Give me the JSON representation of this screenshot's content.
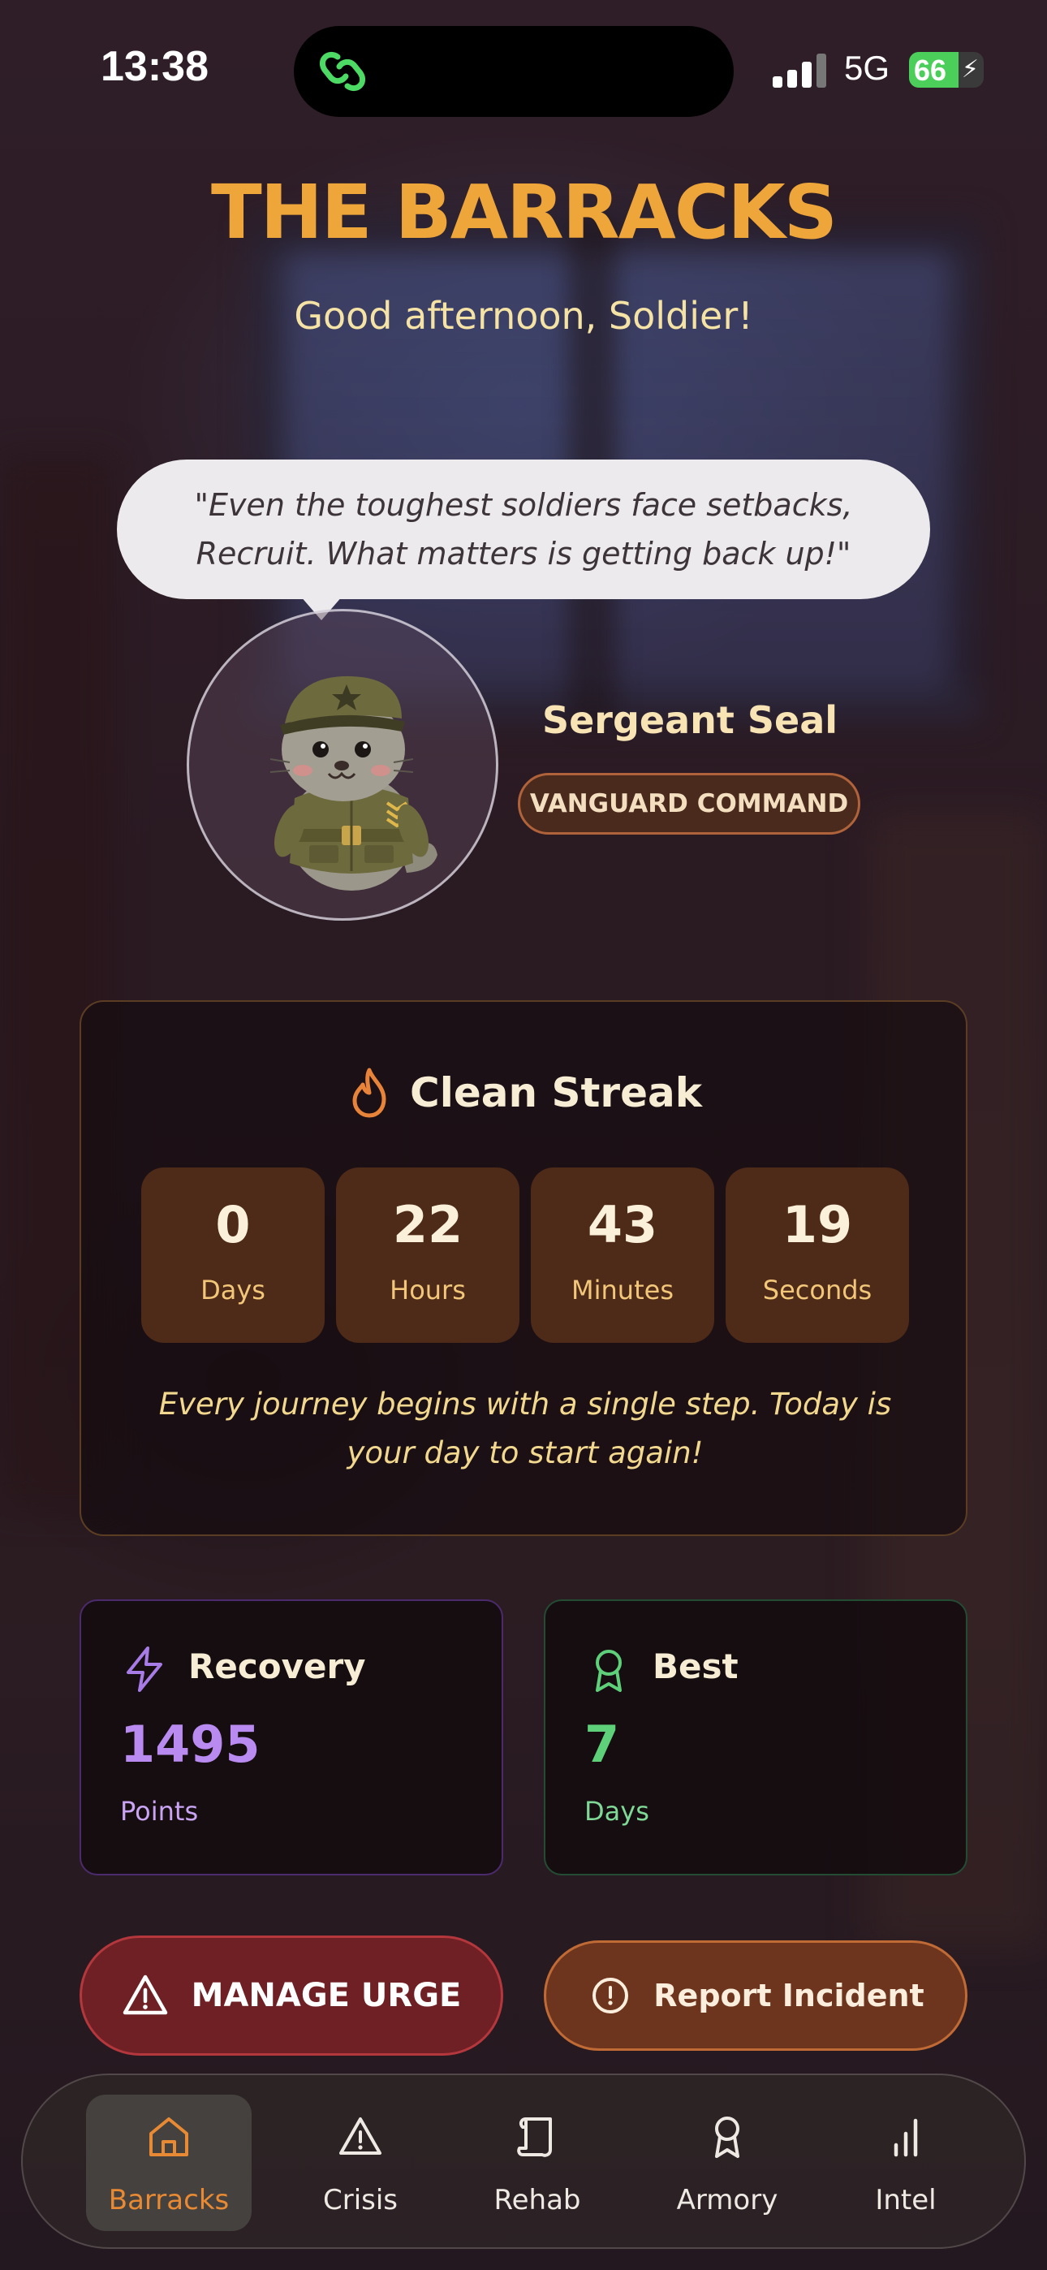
{
  "status_bar": {
    "time": "13:38",
    "network": "5G",
    "battery": "66",
    "battery_level": 0.66
  },
  "header": {
    "title": "THE BARRACKS",
    "greeting": "Good afternoon, Soldier!"
  },
  "mascot": {
    "quote": "\"Even the toughest soldiers face setbacks, Recruit. What matters is getting back up!\"",
    "name": "Sergeant Seal",
    "unit": "VANGUARD COMMAND"
  },
  "streak": {
    "title": "Clean Streak",
    "counters": [
      {
        "value": "0",
        "label": "Days"
      },
      {
        "value": "22",
        "label": "Hours"
      },
      {
        "value": "43",
        "label": "Minutes"
      },
      {
        "value": "19",
        "label": "Seconds"
      }
    ],
    "message": "Every journey begins with a single step. Today is your day to start again!"
  },
  "stats": {
    "recovery": {
      "title": "Recovery",
      "value": "1495",
      "label": "Points"
    },
    "best": {
      "title": "Best",
      "value": "7",
      "label": "Days"
    }
  },
  "actions": {
    "manage_urge": "MANAGE URGE",
    "report_incident": "Report Incident"
  },
  "tabs": [
    {
      "label": "Barracks",
      "icon": "home-icon",
      "active": true
    },
    {
      "label": "Crisis",
      "icon": "warning-icon",
      "active": false
    },
    {
      "label": "Rehab",
      "icon": "scroll-icon",
      "active": false
    },
    {
      "label": "Armory",
      "icon": "medal-icon",
      "active": false
    },
    {
      "label": "Intel",
      "icon": "bar-chart-icon",
      "active": false
    }
  ],
  "colors": {
    "accent_orange": "#eea63a",
    "urge_red": "#6f2024",
    "recovery_purple": "#b98af0",
    "best_green": "#5fd07a"
  }
}
